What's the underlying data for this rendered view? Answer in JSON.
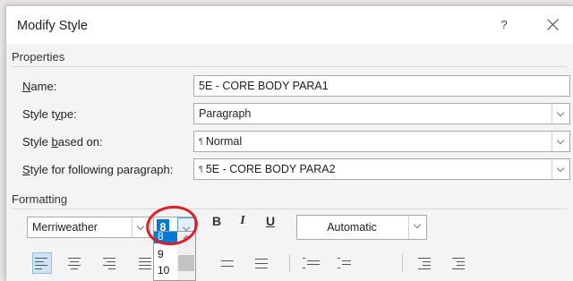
{
  "dialog": {
    "title": "Modify Style",
    "help_label": "?"
  },
  "properties": {
    "section_label": "Properties",
    "name": {
      "label_pre": "",
      "label_u": "N",
      "label_post": "ame:",
      "value": "5E - CORE BODY PARA1"
    },
    "style_type": {
      "label_pre": "Style t",
      "label_u": "y",
      "label_post": "pe:",
      "value": "Paragraph"
    },
    "style_based_on": {
      "label_pre": "Style ",
      "label_u": "b",
      "label_post": "ased on:",
      "value": "Normal",
      "mark": "¶"
    },
    "style_following": {
      "label_pre": "",
      "label_u": "S",
      "label_post": "tyle for following paragraph:",
      "value": "5E - CORE BODY PARA2",
      "mark": "¶"
    }
  },
  "formatting": {
    "section_label": "Formatting",
    "font_name": "Merriweather",
    "font_size": "8",
    "font_size_options": [
      "8",
      "9",
      "10"
    ],
    "bold_label": "B",
    "italic_label": "I",
    "underline_label": "U",
    "color_value": "Automatic"
  },
  "colors": {
    "annotation": "#dc1f2a",
    "selection": "#0078d7"
  }
}
